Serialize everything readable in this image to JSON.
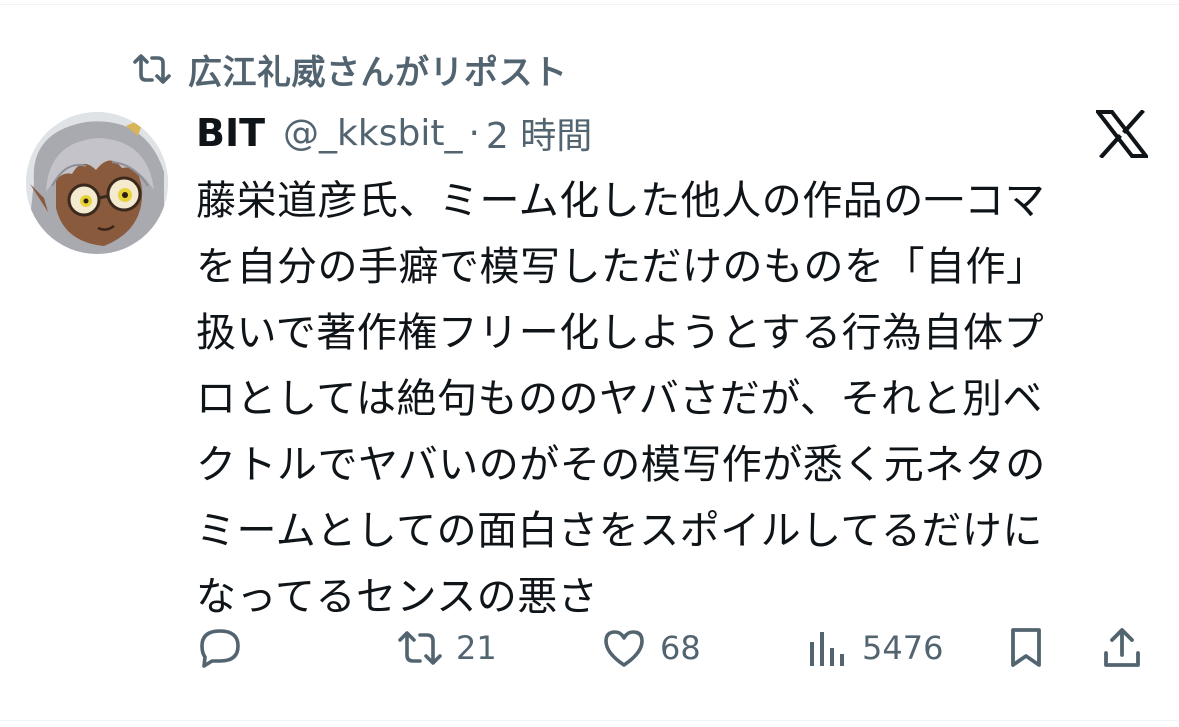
{
  "repost": {
    "label": "広江礼威さんがリポスト",
    "icon": "repost-icon"
  },
  "author": {
    "display_name": "BIT",
    "handle": "@_kksbit_",
    "separator": "·",
    "time": "2 時間",
    "avatar_icon": "avatar-illustration"
  },
  "logo": "x-logo-icon",
  "tweet": {
    "text": "藤栄道彦氏、ミーム化した他人の作品の一コマ\nを自分の手癖で模写しただけのものを「自作」\n扱いで著作権フリー化しようとする行為自体プ\nロとしては絶句もののヤバさだが、それと別ベ\nクトルでヤバいのがその模写作が悉く元ネタの\nミームとしての面白さをスポイルしてるだけに\nなってるセンスの悪さ"
  },
  "actions": {
    "reply": {
      "icon": "reply-icon",
      "count": ""
    },
    "repost": {
      "icon": "repost-icon",
      "count": "21"
    },
    "like": {
      "icon": "heart-icon",
      "count": "68"
    },
    "views": {
      "icon": "views-chart-icon",
      "count": "5476"
    },
    "bookmark": {
      "icon": "bookmark-icon"
    },
    "share": {
      "icon": "share-icon"
    }
  },
  "colors": {
    "text_primary": "#0f1419",
    "text_secondary": "#536471",
    "divider": "#eff3f4"
  }
}
